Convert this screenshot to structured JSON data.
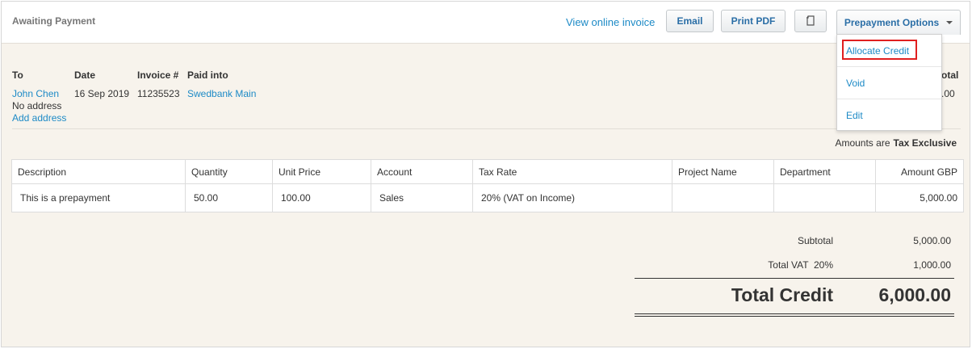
{
  "status": "Awaiting Payment",
  "toolbar": {
    "view_invoice": "View online invoice",
    "email": "Email",
    "print_pdf": "Print PDF",
    "copy_icon": "copy-icon",
    "prepayment_options": "Prepayment Options"
  },
  "dropdown": {
    "items": [
      "Allocate Credit",
      "Void",
      "Edit"
    ]
  },
  "header": {
    "to_label": "To",
    "to_name": "John Chen",
    "no_address": "No address",
    "add_address": "Add address",
    "date_label": "Date",
    "date_value": "16 Sep 2019",
    "invoice_label": "Invoice #",
    "invoice_value": "11235523",
    "paid_into_label": "Paid into",
    "paid_into_value": "Swedbank Main",
    "total_label_partial": "otal",
    "total_value_partial": ".00"
  },
  "amounts_note": {
    "prefix": "Amounts are",
    "value": "Tax Exclusive"
  },
  "table": {
    "columns": [
      "Description",
      "Quantity",
      "Unit Price",
      "Account",
      "Tax Rate",
      "Project Name",
      "Department",
      "Amount GBP"
    ],
    "rows": [
      [
        "This is a prepayment",
        "50.00",
        "100.00",
        "Sales",
        "20% (VAT on Income)",
        "",
        "",
        "5,000.00"
      ]
    ]
  },
  "summary": {
    "subtotal_label": "Subtotal",
    "subtotal_value": "5,000.00",
    "vat_label": "Total VAT  20%",
    "vat_value": "1,000.00",
    "total_label": "Total Credit",
    "total_value": "6,000.00"
  },
  "colors": {
    "link": "#1d8ac6",
    "highlight": "#e01f1f",
    "background": "#f7f3ec"
  }
}
